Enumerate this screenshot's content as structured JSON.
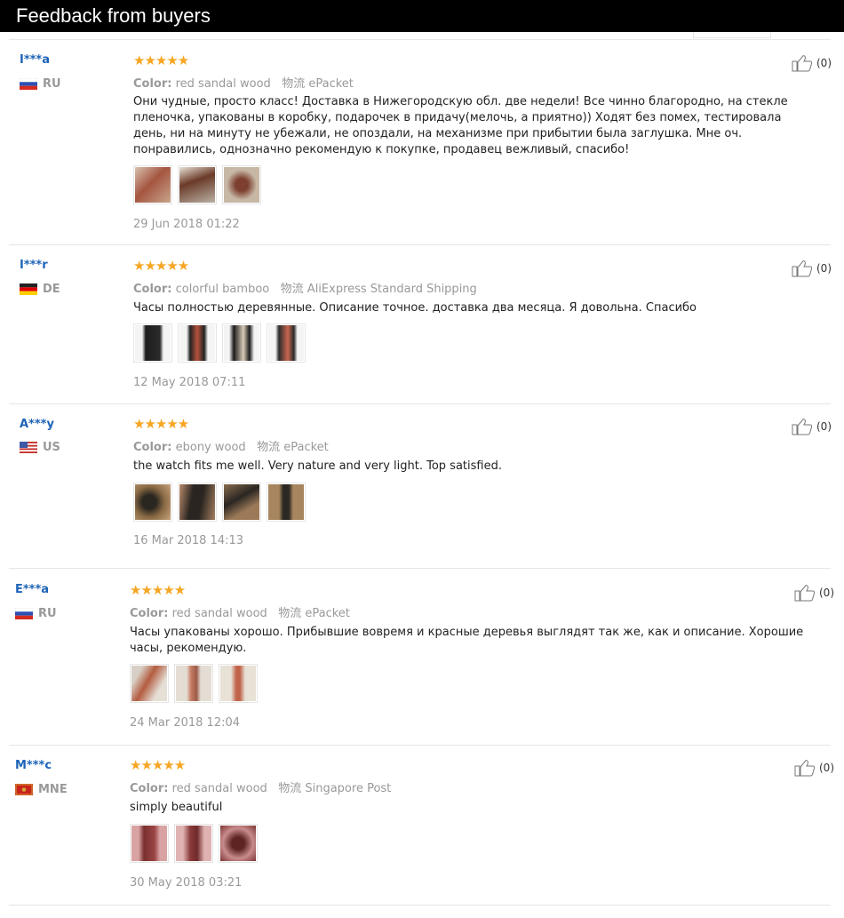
{
  "header": {
    "title": "Feedback from buyers"
  },
  "reviews": [
    {
      "user": "I***a",
      "country": "RU",
      "color_label": "Color:",
      "color": "red sandal wood",
      "ship_label": "物流",
      "ship": "ePacket",
      "text": "Они чудные, просто класс! Доставка в Нижегородскую обл. две недели! Все чинно благородно, на стекле пленочка, упакованы в коробку, подарочек в придачу(мелочь, а приятно)) Ходят без помех, тестировала день, ни на минуту не убежали, не опоздали, на механизме при прибытии была заглушка. Мне оч. понравились, однозначно рекомендую к покупке, продавец вежливый, спасибо!",
      "date": "29 Jun 2018 01:22",
      "likes": "(0)",
      "rating": 5,
      "photos": 3
    },
    {
      "user": "I***r",
      "country": "DE",
      "color_label": "Color:",
      "color": "colorful bamboo",
      "ship_label": "物流",
      "ship": "AliExpress Standard Shipping",
      "text": "Часы полностью деревянные. Описание точное. доставка два месяца. Я довольна. Спасибо",
      "date": "12 May 2018 07:11",
      "likes": "(0)",
      "rating": 5,
      "photos": 4
    },
    {
      "user": "A***y",
      "country": "US",
      "color_label": "Color:",
      "color": "ebony wood",
      "ship_label": "物流",
      "ship": "ePacket",
      "text": "the watch fits me well. Very nature and very light. Top satisfied.",
      "date": "16 Mar 2018 14:13",
      "likes": "(0)",
      "rating": 5,
      "photos": 4
    },
    {
      "user": "E***a",
      "country": "RU",
      "color_label": "Color:",
      "color": "red sandal wood",
      "ship_label": "物流",
      "ship": "ePacket",
      "text": "Часы упакованы хорошо. Прибывшие вовремя и красные деревья выглядят так же, как и описание. Хорошие часы, рекомендую.",
      "date": "24 Mar 2018 12:04",
      "likes": "(0)",
      "rating": 5,
      "photos": 3
    },
    {
      "user": "M***c",
      "country": "MNE",
      "color_label": "Color:",
      "color": "red sandal wood",
      "ship_label": "物流",
      "ship": "Singapore Post",
      "text": "simply beautiful",
      "date": "30 May 2018 03:21",
      "likes": "(0)",
      "rating": 5,
      "photos": 3
    }
  ]
}
